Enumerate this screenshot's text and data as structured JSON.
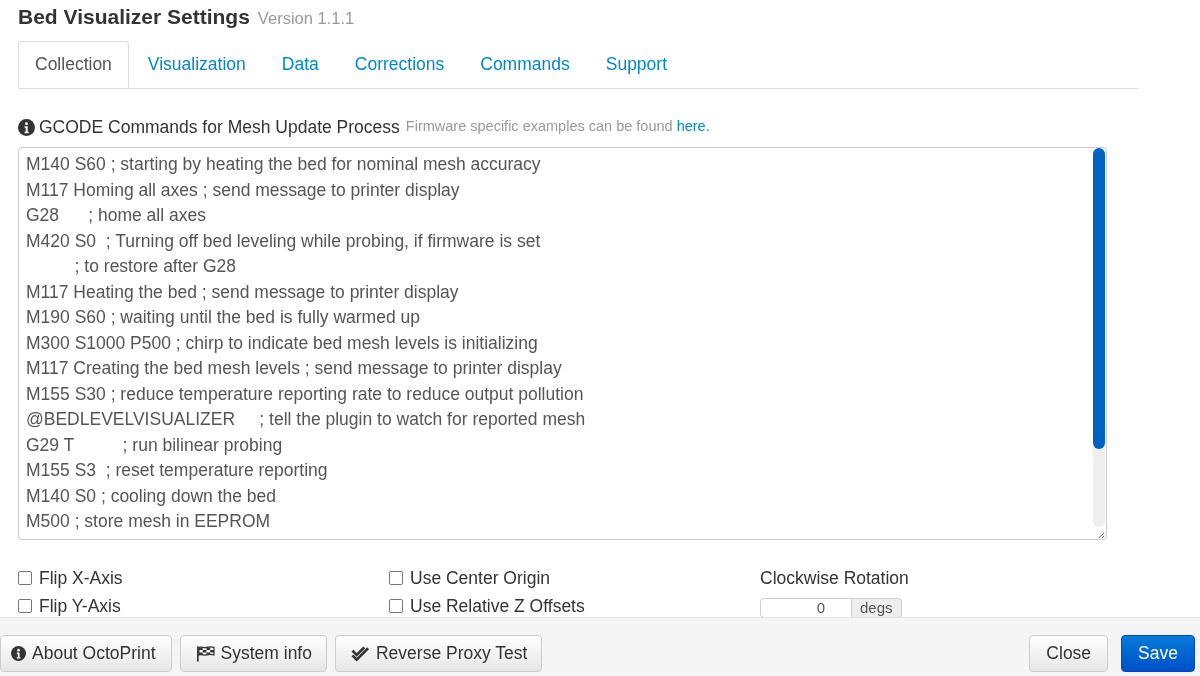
{
  "dialog": {
    "title": "Bed Visualizer Settings",
    "version": "Version 1.1.1"
  },
  "tabs": [
    {
      "label": "Collection",
      "selected": true
    },
    {
      "label": "Visualization",
      "selected": false
    },
    {
      "label": "Data",
      "selected": false
    },
    {
      "label": "Corrections",
      "selected": false
    },
    {
      "label": "Commands",
      "selected": false
    },
    {
      "label": "Support",
      "selected": false
    }
  ],
  "gcode": {
    "label": "GCODE Commands for Mesh Update Process",
    "hint": "Firmware specific examples can be found",
    "link": "here.",
    "lines": [
      "M140 S60 ; starting by heating the bed for nominal mesh accuracy",
      "M117 Homing all axes ; send message to printer display",
      "G28      ; home all axes",
      "M420 S0  ; Turning off bed leveling while probing, if firmware is set",
      "          ; to restore after G28",
      "M117 Heating the bed ; send message to printer display",
      "M190 S60 ; waiting until the bed is fully warmed up",
      "M300 S1000 P500 ; chirp to indicate bed mesh levels is initializing",
      "M117 Creating the bed mesh levels ; send message to printer display",
      "M155 S30 ; reduce temperature reporting rate to reduce output pollution",
      "@BEDLEVELVISUALIZER     ; tell the plugin to watch for reported mesh",
      "G29 T          ; run bilinear probing",
      "M155 S3  ; reset temperature reporting",
      "M140 S0 ; cooling down the bed",
      "M500 ; store mesh in EEPROM"
    ]
  },
  "options": {
    "columns": [
      [
        {
          "label": "Flip X-Axis",
          "checked": false
        },
        {
          "label": "Flip Y-Axis",
          "checked": false
        }
      ],
      [
        {
          "label": "Use Center Origin",
          "checked": false
        },
        {
          "label": "Use Relative Z Offsets",
          "checked": false
        }
      ]
    ],
    "rotation": {
      "label": "Clockwise Rotation",
      "value": "0",
      "unit": "degs"
    }
  },
  "footer": {
    "left_buttons": [
      "About OctoPrint",
      "System info",
      "Reverse Proxy Test"
    ],
    "right_buttons": [
      {
        "label": "Close",
        "kind": "default"
      },
      {
        "label": "Save",
        "kind": "primary"
      }
    ]
  }
}
